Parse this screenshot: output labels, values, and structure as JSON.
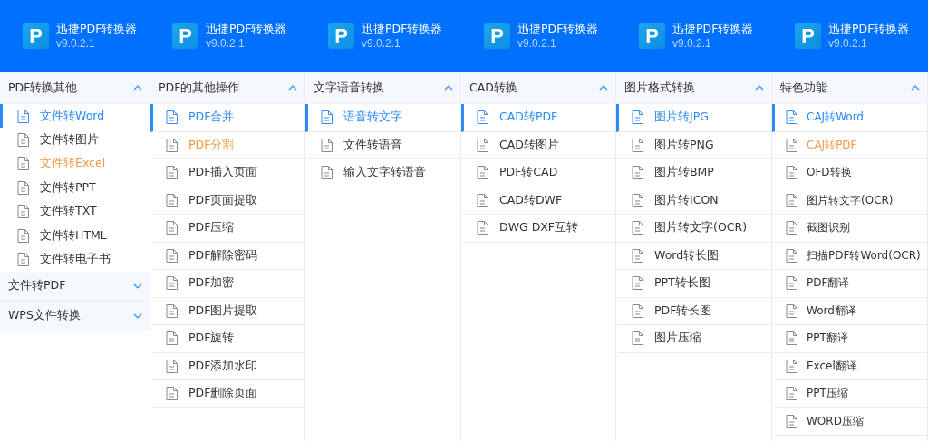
{
  "header": {
    "apps": [
      {
        "logo": "P",
        "name": "迅捷PDF转换器",
        "version": "v9.0.2.1"
      },
      {
        "logo": "P",
        "name": "迅捷PDF转换器",
        "version": "v9.0.2.1"
      },
      {
        "logo": "P",
        "name": "迅捷PDF转换器",
        "version": "v9.0.2.1"
      },
      {
        "logo": "P",
        "name": "迅捷PDF转换器",
        "version": "v9.0.2.1"
      },
      {
        "logo": "P",
        "name": "迅捷PDF转换器",
        "version": "v9.0.2.1"
      },
      {
        "logo": "P",
        "name": "迅捷PDF转换器",
        "version": "v9.0.2.1"
      }
    ]
  },
  "panels": [
    {
      "kind": "compact",
      "groups": [
        {
          "title": "PDF转换其他",
          "expanded": true,
          "items": [
            {
              "label": "文件转Word",
              "selected": true,
              "highlighted": false
            },
            {
              "label": "文件转图片",
              "selected": false,
              "highlighted": false
            },
            {
              "label": "文件转Excel",
              "selected": false,
              "highlighted": true
            },
            {
              "label": "文件转PPT",
              "selected": false,
              "highlighted": false
            },
            {
              "label": "文件转TXT",
              "selected": false,
              "highlighted": false
            },
            {
              "label": "文件转HTML",
              "selected": false,
              "highlighted": false
            },
            {
              "label": "文件转电子书",
              "selected": false,
              "highlighted": false
            }
          ]
        },
        {
          "title": "文件转PDF",
          "expanded": false
        },
        {
          "title": "WPS文件转换",
          "expanded": false
        }
      ]
    },
    {
      "kind": "list",
      "groups": [
        {
          "title": "PDF的其他操作",
          "expanded": true,
          "items": [
            {
              "label": "PDF合并",
              "selected": true,
              "highlighted": false
            },
            {
              "label": "PDF分割",
              "selected": false,
              "highlighted": true
            },
            {
              "label": "PDF插入页面",
              "selected": false,
              "highlighted": false
            },
            {
              "label": "PDF页面提取",
              "selected": false,
              "highlighted": false
            },
            {
              "label": "PDF压缩",
              "selected": false,
              "highlighted": false
            },
            {
              "label": "PDF解除密码",
              "selected": false,
              "highlighted": false
            },
            {
              "label": "PDF加密",
              "selected": false,
              "highlighted": false
            },
            {
              "label": "PDF图片提取",
              "selected": false,
              "highlighted": false
            },
            {
              "label": "PDF旋转",
              "selected": false,
              "highlighted": false
            },
            {
              "label": "PDF添加水印",
              "selected": false,
              "highlighted": false
            },
            {
              "label": "PDF删除页面",
              "selected": false,
              "highlighted": false
            }
          ]
        }
      ]
    },
    {
      "kind": "list",
      "groups": [
        {
          "title": "文字语音转换",
          "expanded": true,
          "items": [
            {
              "label": "语音转文字",
              "selected": true,
              "highlighted": false
            },
            {
              "label": "文件转语音",
              "selected": false,
              "highlighted": false
            },
            {
              "label": "输入文字转语音",
              "selected": false,
              "highlighted": false
            }
          ]
        }
      ]
    },
    {
      "kind": "list",
      "groups": [
        {
          "title": "CAD转换",
          "expanded": true,
          "items": [
            {
              "label": "CAD转PDF",
              "selected": true,
              "highlighted": false
            },
            {
              "label": "CAD转图片",
              "selected": false,
              "highlighted": false
            },
            {
              "label": "PDF转CAD",
              "selected": false,
              "highlighted": false
            },
            {
              "label": "CAD转DWF",
              "selected": false,
              "highlighted": false
            },
            {
              "label": "DWG DXF互转",
              "selected": false,
              "highlighted": false
            }
          ]
        }
      ]
    },
    {
      "kind": "list",
      "groups": [
        {
          "title": "图片格式转换",
          "expanded": true,
          "items": [
            {
              "label": "图片转JPG",
              "selected": true,
              "highlighted": false
            },
            {
              "label": "图片转PNG",
              "selected": false,
              "highlighted": false
            },
            {
              "label": "图片转BMP",
              "selected": false,
              "highlighted": false
            },
            {
              "label": "图片转ICON",
              "selected": false,
              "highlighted": false
            },
            {
              "label": "图片转文字(OCR)",
              "selected": false,
              "highlighted": false
            },
            {
              "label": "Word转长图",
              "selected": false,
              "highlighted": false
            },
            {
              "label": "PPT转长图",
              "selected": false,
              "highlighted": false
            },
            {
              "label": "PDF转长图",
              "selected": false,
              "highlighted": false
            },
            {
              "label": "图片压缩",
              "selected": false,
              "highlighted": false
            }
          ]
        }
      ]
    },
    {
      "kind": "list",
      "groups": [
        {
          "title": "特色功能",
          "expanded": true,
          "items": [
            {
              "label": "CAJ转Word",
              "selected": true,
              "highlighted": false
            },
            {
              "label": "CAJ转PDF",
              "selected": false,
              "highlighted": true
            },
            {
              "label": "OFD转换",
              "selected": false,
              "highlighted": false
            },
            {
              "label": "图片转文字(OCR)",
              "selected": false,
              "highlighted": false
            },
            {
              "label": "截图识别",
              "selected": false,
              "highlighted": false
            },
            {
              "label": "扫描PDF转Word(OCR)",
              "selected": false,
              "highlighted": false
            },
            {
              "label": "PDF翻译",
              "selected": false,
              "highlighted": false
            },
            {
              "label": "Word翻译",
              "selected": false,
              "highlighted": false
            },
            {
              "label": "PPT翻译",
              "selected": false,
              "highlighted": false
            },
            {
              "label": "Excel翻译",
              "selected": false,
              "highlighted": false
            },
            {
              "label": "PPT压缩",
              "selected": false,
              "highlighted": false
            },
            {
              "label": "WORD压缩",
              "selected": false,
              "highlighted": false
            }
          ]
        }
      ]
    }
  ]
}
